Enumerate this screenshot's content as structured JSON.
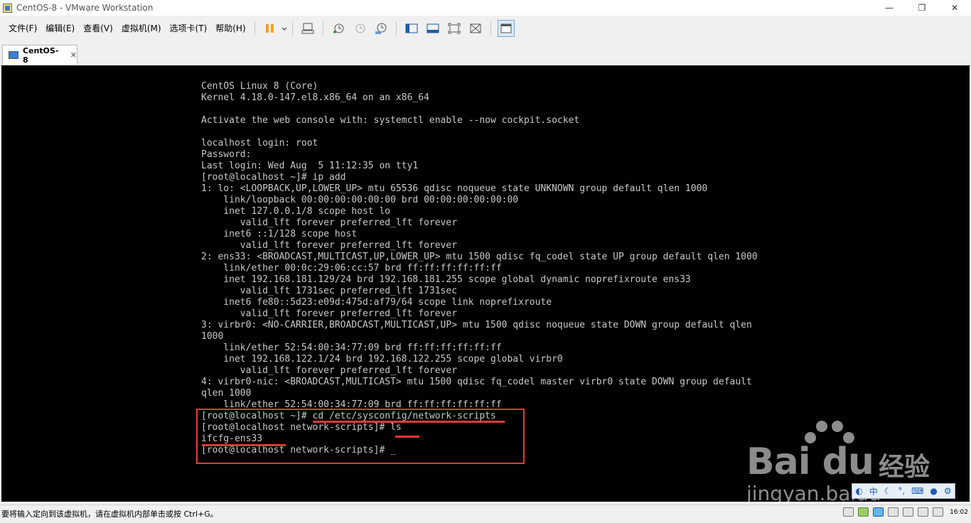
{
  "window": {
    "title": "CentOS-8 - VMware Workstation",
    "minimize": "—",
    "restore": "❐",
    "close": "✕"
  },
  "menu": [
    {
      "name": "menu-file",
      "label": "文件(F)"
    },
    {
      "name": "menu-edit",
      "label": "编辑(E)"
    },
    {
      "name": "menu-view",
      "label": "查看(V)"
    },
    {
      "name": "menu-vm",
      "label": "虚拟机(M)"
    },
    {
      "name": "menu-tabs",
      "label": "选项卡(T)"
    },
    {
      "name": "menu-help",
      "label": "帮助(H)"
    }
  ],
  "tab": {
    "label": "CentOS-8",
    "close": "✕"
  },
  "console": {
    "lines": [
      "CentOS Linux 8 (Core)",
      "Kernel 4.18.0-147.el8.x86_64 on an x86_64",
      "",
      "Activate the web console with: systemctl enable --now cockpit.socket",
      "",
      "localhost login: root",
      "Password:",
      "Last login: Wed Aug  5 11:12:35 on tty1",
      "[root@localhost ~]# ip add",
      "1: lo: <LOOPBACK,UP,LOWER_UP> mtu 65536 qdisc noqueue state UNKNOWN group default qlen 1000",
      "    link/loopback 00:00:00:00:00:00 brd 00:00:00:00:00:00",
      "    inet 127.0.0.1/8 scope host lo",
      "       valid_lft forever preferred_lft forever",
      "    inet6 ::1/128 scope host",
      "       valid_lft forever preferred_lft forever",
      "2: ens33: <BROADCAST,MULTICAST,UP,LOWER_UP> mtu 1500 qdisc fq_codel state UP group default qlen 1000",
      "    link/ether 00:0c:29:06:cc:57 brd ff:ff:ff:ff:ff:ff",
      "    inet 192.168.181.129/24 brd 192.168.181.255 scope global dynamic noprefixroute ens33",
      "       valid_lft 1731sec preferred_lft 1731sec",
      "    inet6 fe80::5d23:e09d:475d:af79/64 scope link noprefixroute",
      "       valid_lft forever preferred_lft forever",
      "3: virbr0: <NO-CARRIER,BROADCAST,MULTICAST,UP> mtu 1500 qdisc noqueue state DOWN group default qlen",
      "1000",
      "    link/ether 52:54:00:34:77:09 brd ff:ff:ff:ff:ff:ff",
      "    inet 192.168.122.1/24 brd 192.168.122.255 scope global virbr0",
      "       valid_lft forever preferred_lft forever",
      "4: virbr0-nic: <BROADCAST,MULTICAST> mtu 1500 qdisc fq_codel master virbr0 state DOWN group default",
      "qlen 1000",
      "    link/ether 52:54:00:34:77:09 brd ff:ff:ff:ff:ff:ff",
      "[root@localhost ~]# cd /etc/sysconfig/network-scripts",
      "[root@localhost network-scripts]# ls",
      "ifcfg-ens33",
      "[root@localhost network-scripts]# _"
    ]
  },
  "watermark": {
    "brand": "Bai du",
    "cn": "经验",
    "url": "jingyan.baidu"
  },
  "ime": {
    "lang": "中"
  },
  "status": {
    "hint": "要将输入定向到该虚拟机，请在虚拟机内部单击或按 Ctrl+G。",
    "clock": "16:02"
  },
  "colors": {
    "console_bg": "#000000",
    "console_text": "#c8c8c8",
    "annotation": "#e53935"
  }
}
